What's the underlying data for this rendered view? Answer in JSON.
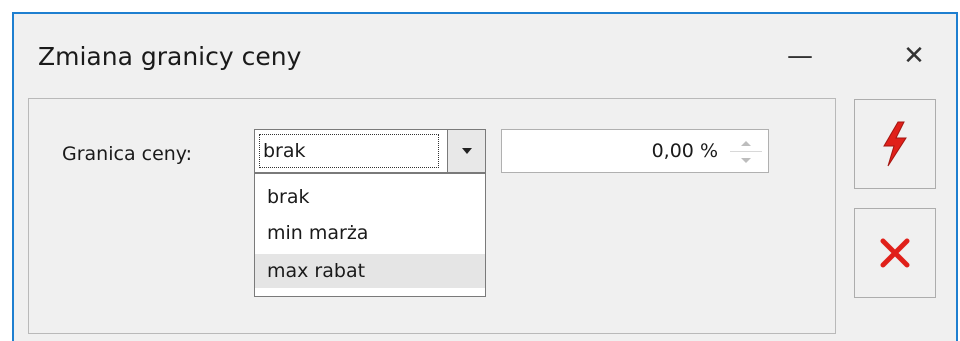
{
  "window": {
    "title": "Zmiana granicy ceny",
    "minimize_glyph": "—",
    "close_glyph": "✕"
  },
  "form": {
    "price_limit_label": "Granica ceny:",
    "combo": {
      "selected": "brak",
      "options": [
        "brak",
        "min marża",
        "max rabat"
      ],
      "highlighted": "max rabat"
    },
    "percent_value": "0,00 %"
  },
  "buttons": {
    "confirm_icon": "lightning-bolt-icon",
    "cancel_icon": "red-x-icon"
  },
  "colors": {
    "window_border": "#1e7fd0",
    "confirm_red": "#e0201a",
    "cancel_red": "#e0201a",
    "highlight": "#e5e5e5"
  }
}
